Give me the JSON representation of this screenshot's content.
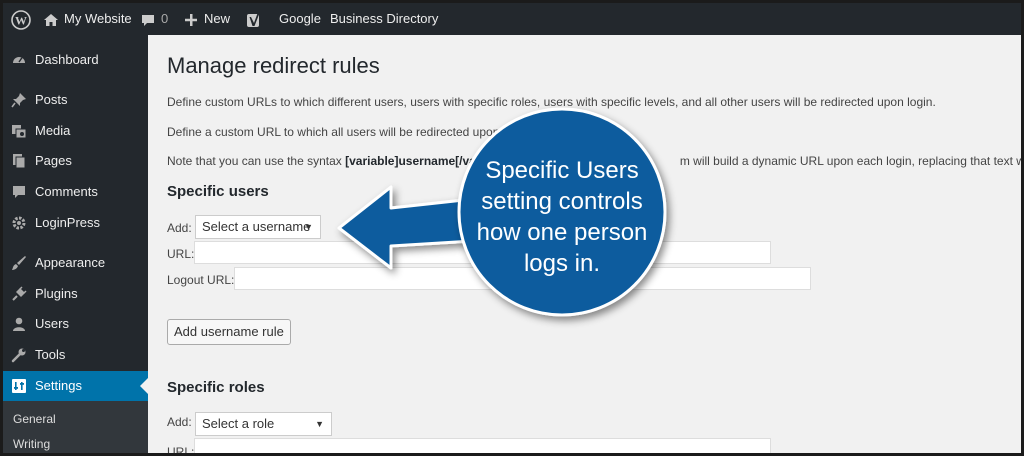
{
  "adminbar": {
    "site_name": "My Website",
    "comments_count": "0",
    "new_label": "New",
    "google_label": "Google",
    "directory_label": "Business Directory"
  },
  "sidebar": {
    "items": [
      {
        "label": "Dashboard",
        "icon": "dashboard-icon"
      },
      {
        "label": "Posts",
        "icon": "pin-icon"
      },
      {
        "label": "Media",
        "icon": "media-icon"
      },
      {
        "label": "Pages",
        "icon": "pages-icon"
      },
      {
        "label": "Comments",
        "icon": "comment-icon"
      },
      {
        "label": "LoginPress",
        "icon": "gear-icon"
      },
      {
        "label": "Appearance",
        "icon": "brush-icon"
      },
      {
        "label": "Plugins",
        "icon": "plug-icon"
      },
      {
        "label": "Users",
        "icon": "user-icon"
      },
      {
        "label": "Tools",
        "icon": "wrench-icon"
      },
      {
        "label": "Settings",
        "icon": "settings-icon"
      }
    ],
    "submenu": [
      "General",
      "Writing"
    ]
  },
  "main": {
    "title": "Manage redirect rules",
    "intro1": "Define custom URLs to which different users, users with specific roles, users with specific levels, and all other users will be redirected upon login.",
    "intro2": "Define a custom URL to which all users will be redirected upon l",
    "intro3_prefix": "Note that you can use the syntax ",
    "intro3_bold": "[variable]username[/vari",
    "intro3_suffix": "m will build a dynamic URL upon each login, replacing that text with the",
    "specific_users": {
      "heading": "Specific users",
      "add_label": "Add:",
      "select_value": "Select a username",
      "url_label": "URL:",
      "logout_label": "Logout URL:",
      "button_label": "Add username rule"
    },
    "specific_roles": {
      "heading": "Specific roles",
      "add_label": "Add:",
      "select_value": "Select a role",
      "url_label": "URL:"
    }
  },
  "callout": {
    "text": "Specific Users setting controls how one person logs in.",
    "color": "#0b5c9e"
  },
  "colors": {
    "adminbar": "#23282d",
    "sidebar": "#23282d",
    "accent": "#0073aa",
    "content_bg": "#f1f1f1"
  }
}
